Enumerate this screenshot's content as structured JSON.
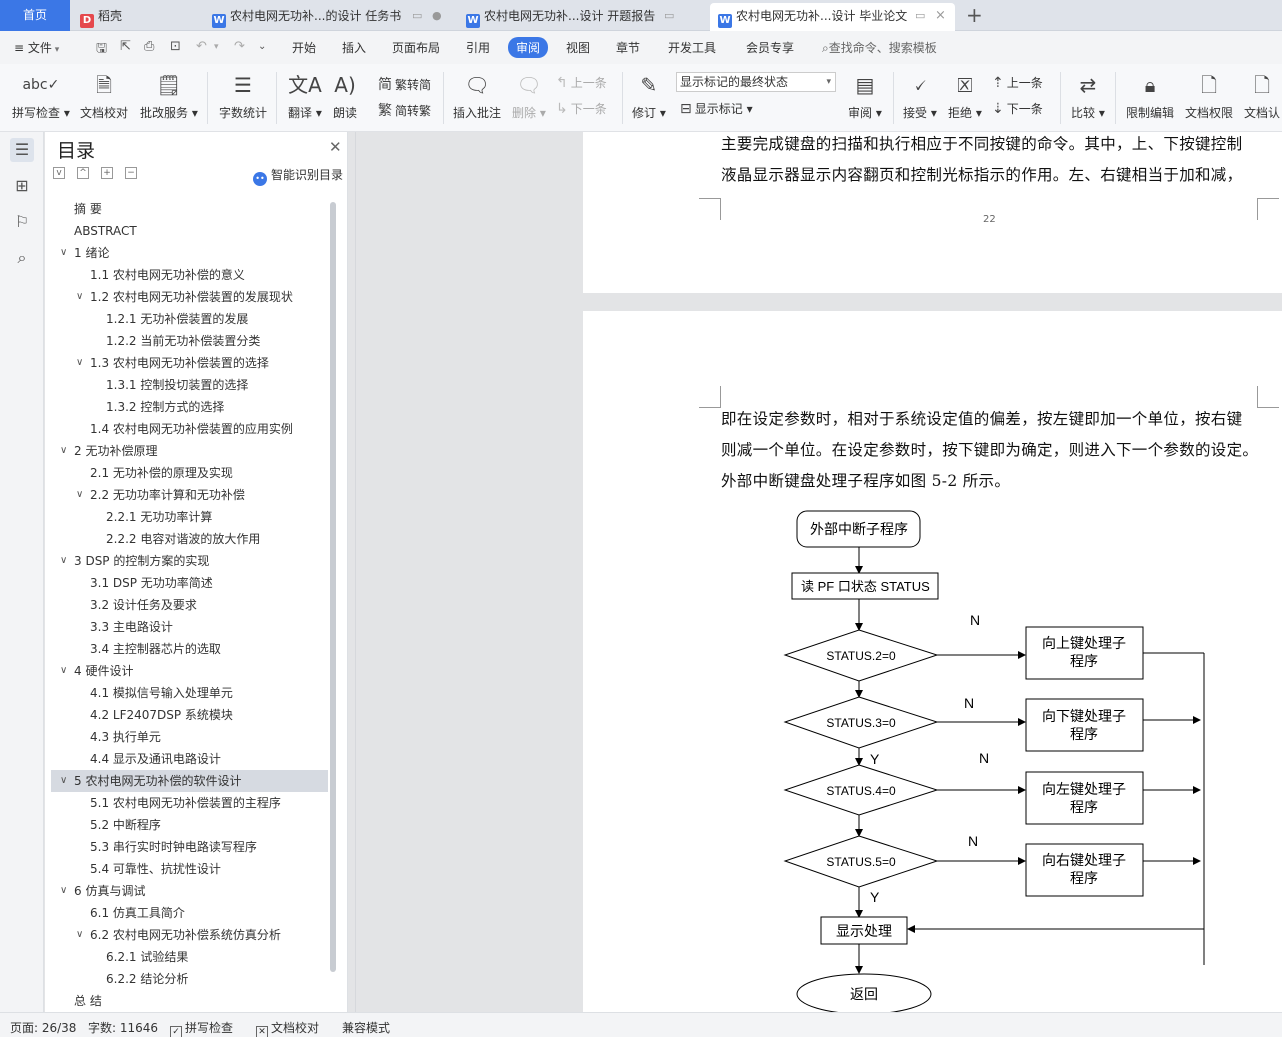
{
  "tabs": {
    "home": "首页",
    "items": [
      {
        "icon": "D",
        "icon_color": "#e5484d",
        "label": "稻壳"
      },
      {
        "icon": "W",
        "icon_color": "#3b77e6",
        "label": "农村电网无功补...的设计 任务书"
      },
      {
        "icon": "W",
        "icon_color": "#3b77e6",
        "label": "农村电网无功补...设计 开题报告"
      },
      {
        "icon": "W",
        "icon_color": "#3b77e6",
        "label": "农村电网无功补...设计 毕业论文"
      }
    ],
    "new_tab": "+"
  },
  "menu": {
    "file": "文件",
    "items": [
      "开始",
      "插入",
      "页面布局",
      "引用",
      "审阅",
      "视图",
      "章节",
      "开发工具",
      "会员专享"
    ],
    "active": "审阅",
    "search_placeholder": "查找命令、搜索模板"
  },
  "ribbon": {
    "spell_check": "拼写检查",
    "doc_proof": "文档校对",
    "batch_service": "批改服务",
    "word_count": "字数统计",
    "translate": "翻译",
    "read_aloud": "朗读",
    "trad_to_simp": "繁转简",
    "simp_to_trad": "简转繁",
    "insert_comment": "插入批注",
    "delete": "删除",
    "prev": "上一条",
    "next": "下一条",
    "revise": "修订",
    "markup_state": "显示标记的最终状态",
    "show_markup": "显示标记",
    "review": "审阅",
    "accept": "接受",
    "reject": "拒绝",
    "prev2": "上一条",
    "next2": "下一条",
    "compare": "比较",
    "restrict_edit": "限制编辑",
    "doc_rights": "文档权限",
    "doc_cert": "文档认"
  },
  "toc": {
    "title": "目录",
    "smart_label": "智能识别目录",
    "items": [
      {
        "level": 1,
        "text": "摘  要",
        "chev": ""
      },
      {
        "level": 1,
        "text": "ABSTRACT",
        "chev": ""
      },
      {
        "level": 1,
        "text": "1 绪论",
        "chev": "v"
      },
      {
        "level": 2,
        "text": "1.1 农村电网无功补偿的意义",
        "chev": ""
      },
      {
        "level": 2,
        "text": "1.2 农村电网无功补偿装置的发展现状",
        "chev": "v"
      },
      {
        "level": 3,
        "text": "1.2.1 无功补偿装置的发展",
        "chev": ""
      },
      {
        "level": 3,
        "text": "1.2.2 当前无功补偿装置分类",
        "chev": ""
      },
      {
        "level": 2,
        "text": "1.3 农村电网无功补偿装置的选择",
        "chev": "v"
      },
      {
        "level": 3,
        "text": "1.3.1 控制投切装置的选择",
        "chev": ""
      },
      {
        "level": 3,
        "text": "1.3.2 控制方式的选择",
        "chev": ""
      },
      {
        "level": 2,
        "text": "1.4 农村电网无功补偿装置的应用实例",
        "chev": ""
      },
      {
        "level": 1,
        "text": "2  无功补偿原理",
        "chev": "v"
      },
      {
        "level": 2,
        "text": "2.1 无功补偿的原理及实现",
        "chev": ""
      },
      {
        "level": 2,
        "text": "2.2 无功功率计算和无功补偿",
        "chev": "v"
      },
      {
        "level": 3,
        "text": "2.2.1 无功功率计算",
        "chev": ""
      },
      {
        "level": 3,
        "text": "2.2.2 电容对谐波的放大作用",
        "chev": ""
      },
      {
        "level": 1,
        "text": "3 DSP 的控制方案的实现",
        "chev": "v"
      },
      {
        "level": 2,
        "text": "3.1 DSP 无功功率简述",
        "chev": ""
      },
      {
        "level": 2,
        "text": "3.2 设计任务及要求",
        "chev": ""
      },
      {
        "level": 2,
        "text": "3.3 主电路设计",
        "chev": ""
      },
      {
        "level": 2,
        "text": "3.4 主控制器芯片的选取",
        "chev": ""
      },
      {
        "level": 1,
        "text": "4 硬件设计",
        "chev": "v"
      },
      {
        "level": 2,
        "text": "4.1 模拟信号输入处理单元",
        "chev": ""
      },
      {
        "level": 2,
        "text": "4.2 LF2407DSP 系统模块",
        "chev": ""
      },
      {
        "level": 2,
        "text": "4.3 执行单元",
        "chev": ""
      },
      {
        "level": 2,
        "text": "4.4 显示及通讯电路设计",
        "chev": ""
      },
      {
        "level": 1,
        "text": "5 农村电网无功补偿的软件设计",
        "chev": "v",
        "highlight": true
      },
      {
        "level": 2,
        "text": "5.1 农村电网无功补偿装置的主程序",
        "chev": ""
      },
      {
        "level": 2,
        "text": "5.2 中断程序",
        "chev": ""
      },
      {
        "level": 2,
        "text": "5.3 串行实时时钟电路读写程序",
        "chev": ""
      },
      {
        "level": 2,
        "text": "5.4 可靠性、抗扰性设计",
        "chev": ""
      },
      {
        "level": 1,
        "text": "6 仿真与调试",
        "chev": "v"
      },
      {
        "level": 2,
        "text": "6.1 仿真工具简介",
        "chev": ""
      },
      {
        "level": 2,
        "text": "6.2 农村电网无功补偿系统仿真分析",
        "chev": "v"
      },
      {
        "level": 3,
        "text": "6.2.1 试验结果",
        "chev": ""
      },
      {
        "level": 3,
        "text": "6.2.2 结论分析",
        "chev": ""
      },
      {
        "level": 1,
        "text": "总  结",
        "chev": ""
      }
    ]
  },
  "document": {
    "page1_lines": [
      "主要完成键盘的扫描和执行相应于不同按键的命令。其中，上、下按键控制",
      "液晶显示器显示内容翻页和控制光标指示的作用。左、右键相当于加和减，"
    ],
    "page_number": "22",
    "page2_lines": [
      "即在设定参数时，相对于系统设定值的偏差，按左键即加一个单位，按右键",
      "则减一个单位。在设定参数时，按下键即为确定，则进入下一个参数的设定。",
      "外部中断键盘处理子程序如图 5-2 所示。"
    ],
    "flowchart": {
      "start": "外部中断子程序",
      "read": "读 PF 口状态 STATUS",
      "decisions": [
        "STATUS.2=0",
        "STATUS.3=0",
        "STATUS.4=0",
        "STATUS.5=0"
      ],
      "handlers": [
        [
          "向上键处理子",
          "程序"
        ],
        [
          "向下键处理子",
          "程序"
        ],
        [
          "向左键处理子",
          "程序"
        ],
        [
          "向右键处理子",
          "程序"
        ]
      ],
      "display": "显示处理",
      "end": "返回",
      "yes": "Y",
      "no": "N"
    }
  },
  "status": {
    "page": "页面: 26/38",
    "words": "字数: 11646",
    "spell_check": "拼写检查",
    "doc_proof": "文档校对",
    "compat_mode": "兼容模式"
  }
}
